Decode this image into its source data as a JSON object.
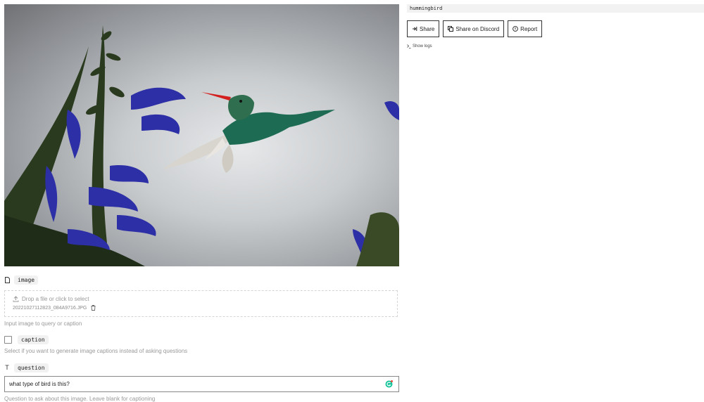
{
  "image_field": {
    "label": "image",
    "drop_hint": "Drop a file or click to select",
    "filename": "20221027112823_084A9716.JPG",
    "help": "Input image to query or caption"
  },
  "caption_field": {
    "label": "caption",
    "help": "Select if you want to generate image captions instead of asking questions",
    "checked": false
  },
  "question_field": {
    "label": "question",
    "value": "what type of bird is this?",
    "help": "Question to ask about this image. Leave blank for captioning"
  },
  "output": {
    "text": "hummingbird"
  },
  "buttons": {
    "share": "Share",
    "share_discord": "Share on Discord",
    "report": "Report"
  },
  "logs": {
    "label": "Show logs"
  }
}
